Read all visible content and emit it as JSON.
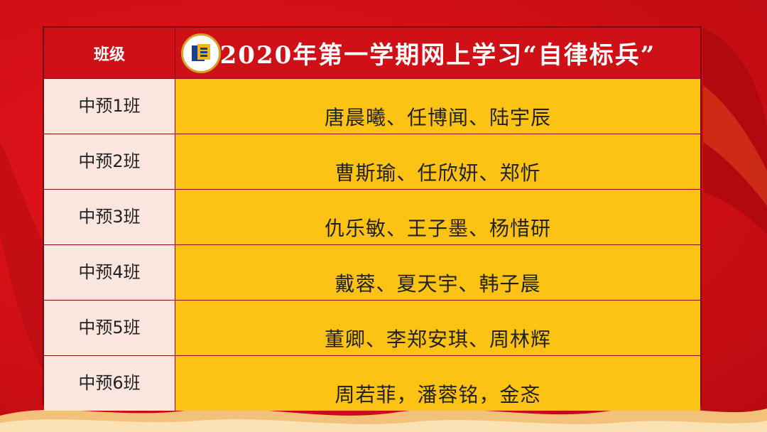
{
  "header": {
    "class_col": "班级",
    "title": "2020年第一学期网上学习“自律标兵”"
  },
  "rows": [
    {
      "class": "中预1班",
      "names": "唐晨曦、任博闻、陆宇辰"
    },
    {
      "class": "中预2班",
      "names": "曹斯瑜、任欣妍、郑忻"
    },
    {
      "class": "中预3班",
      "names": "仇乐敏、王子墨、杨惜研"
    },
    {
      "class": "中预4班",
      "names": "戴蓉、夏天宇、韩子晨"
    },
    {
      "class": "中预5班",
      "names": "董卿、李郑安琪、周林辉"
    },
    {
      "class": "中预6班",
      "names": "周若菲，潘蓉铭，金忞"
    }
  ],
  "colors": {
    "background": "#d40f16",
    "header": "#cf1016",
    "class_cell": "#fbe6df",
    "name_cell": "#fdc314",
    "logo_ring": "#d6a42a"
  },
  "icons": {
    "logo": "school-logo-icon"
  }
}
